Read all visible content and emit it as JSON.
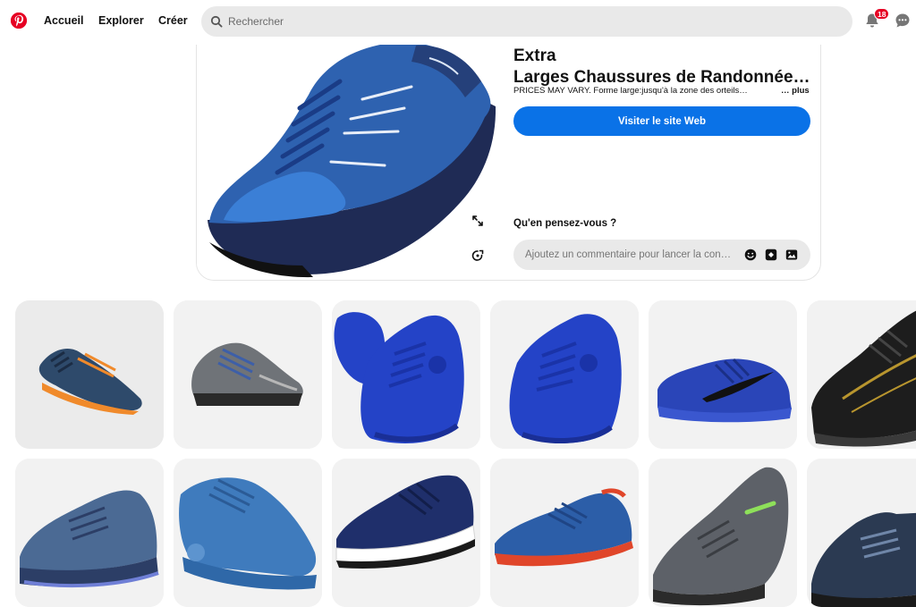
{
  "header": {
    "nav": {
      "home": "Accueil",
      "explore": "Explorer",
      "create": "Créer"
    },
    "search_placeholder": "Rechercher",
    "notification_count": "18",
    "logo_icon": "pinterest-logo",
    "colors": {
      "brand": "#e60023",
      "accent": "#0a72e7"
    }
  },
  "pin": {
    "title_line1": "Fitville Chaussure Trail Homme Extra",
    "title_line2": "Larges Chaussures de Randonnée…",
    "description": "PRICES MAY VARY. Forme large:jusqu'à la zone des orteils…",
    "more_label": "… plus",
    "visit_label": "Visiter le site Web",
    "comments_heading": "Qu'en pensez-vous ?",
    "comment_placeholder": "Ajoutez un commentaire pour lancer la con…"
  },
  "grid": {
    "tiles": [
      {
        "kind": "blue-orange-trail",
        "color": "#2e4a6b",
        "accent": "#f08a2b",
        "bg": "#ececec"
      },
      {
        "kind": "grey-hiking",
        "color": "#6f7378",
        "accent": "#3d5fa8",
        "bg": "#f2f2f2"
      },
      {
        "kind": "royal-blue-pair",
        "color": "#2443c7",
        "accent": "#1a33a8",
        "bg": "#f2f2f2"
      },
      {
        "kind": "royal-blue-single",
        "color": "#2443c7",
        "accent": "#1a33a8",
        "bg": "#f2f2f2"
      },
      {
        "kind": "blue-nike",
        "color": "#2a45b8",
        "accent": "#111111",
        "bg": "#f2f2f2"
      },
      {
        "kind": "black-gold",
        "color": "#1d1d1d",
        "accent": "#b8952e",
        "bg": "#f2f2f2"
      },
      {
        "kind": "steel-blue-trail",
        "color": "#4b6a94",
        "accent": "#2c3e66",
        "bg": "#f2f2f2"
      },
      {
        "kind": "blue-skechers",
        "color": "#3f7bbd",
        "accent": "#ffffff",
        "bg": "#f2f2f2"
      },
      {
        "kind": "navy-runner",
        "color": "#1f2f6b",
        "accent": "#ffffff",
        "bg": "#f2f2f2"
      },
      {
        "kind": "blue-red-runner",
        "color": "#2c5ea8",
        "accent": "#e0462a",
        "bg": "#f2f2f2"
      },
      {
        "kind": "grey-green-runner",
        "color": "#5d6168",
        "accent": "#8ee05a",
        "bg": "#f2f2f2"
      },
      {
        "kind": "dark-hiking",
        "color": "#2b3a52",
        "accent": "#6f86a8",
        "bg": "#f2f2f2"
      }
    ]
  }
}
